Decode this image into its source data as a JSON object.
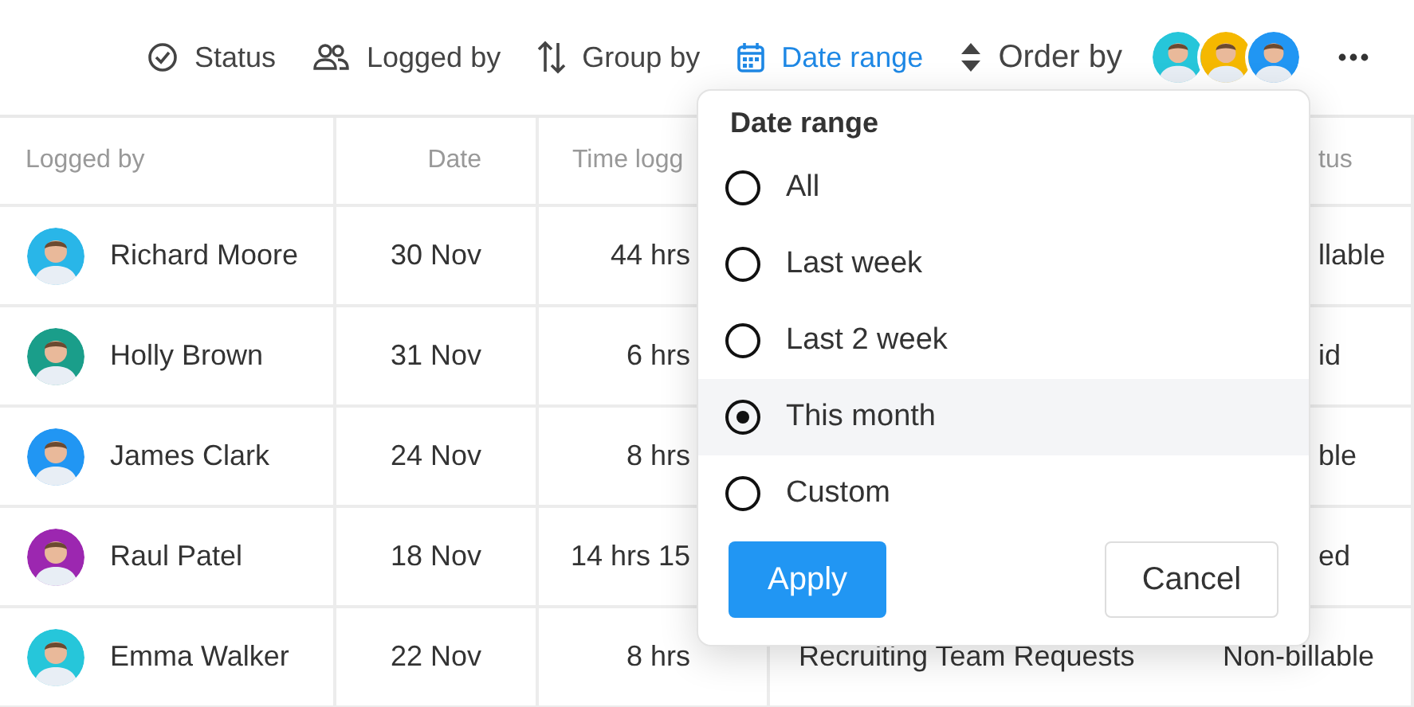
{
  "toolbar": {
    "items": [
      {
        "kind": "status",
        "label": "Status",
        "selected": false
      },
      {
        "kind": "people",
        "label": "Logged by",
        "selected": false
      },
      {
        "kind": "group",
        "label": "Group by",
        "selected": false
      },
      {
        "kind": "calendar",
        "label": "Date range",
        "selected": true
      },
      {
        "kind": "order",
        "label": "Order by",
        "selected": false
      }
    ]
  },
  "table": {
    "header": {
      "logged_by": "Logged by",
      "date": "Date",
      "time_logged": "Time logg",
      "status": "tus"
    },
    "rows": [
      {
        "logged_by": "Richard Moore",
        "date": "30 Nov",
        "time_logged": "44 hrs",
        "status": "llable"
      },
      {
        "logged_by": "Holly Brown",
        "date": "31 Nov",
        "time_logged": "6 hrs",
        "status": "id"
      },
      {
        "logged_by": "James Clark",
        "date": "24 Nov",
        "time_logged": "8 hrs",
        "status": "ble"
      },
      {
        "logged_by": "Raul Patel",
        "date": "18 Nov",
        "time_logged": "14 hrs 15",
        "status": "ed"
      },
      {
        "logged_by": "Emma Walker",
        "date": "22 Nov",
        "time_logged": "8 hrs",
        "column_4": "Recruiting Team Requests",
        "status": "Non-billable"
      }
    ]
  },
  "dropdown": {
    "title": "Date range",
    "options": [
      {
        "label": "All",
        "selected": false
      },
      {
        "label": "Last week",
        "selected": false
      },
      {
        "label": "Last 2 week",
        "selected": false
      },
      {
        "label": "This month",
        "selected": true
      },
      {
        "label": "Custom",
        "selected": false
      }
    ],
    "buttons": [
      {
        "kind": "primary",
        "label": "Apply"
      },
      {
        "kind": "secondary",
        "label": "Cancel"
      }
    ]
  }
}
